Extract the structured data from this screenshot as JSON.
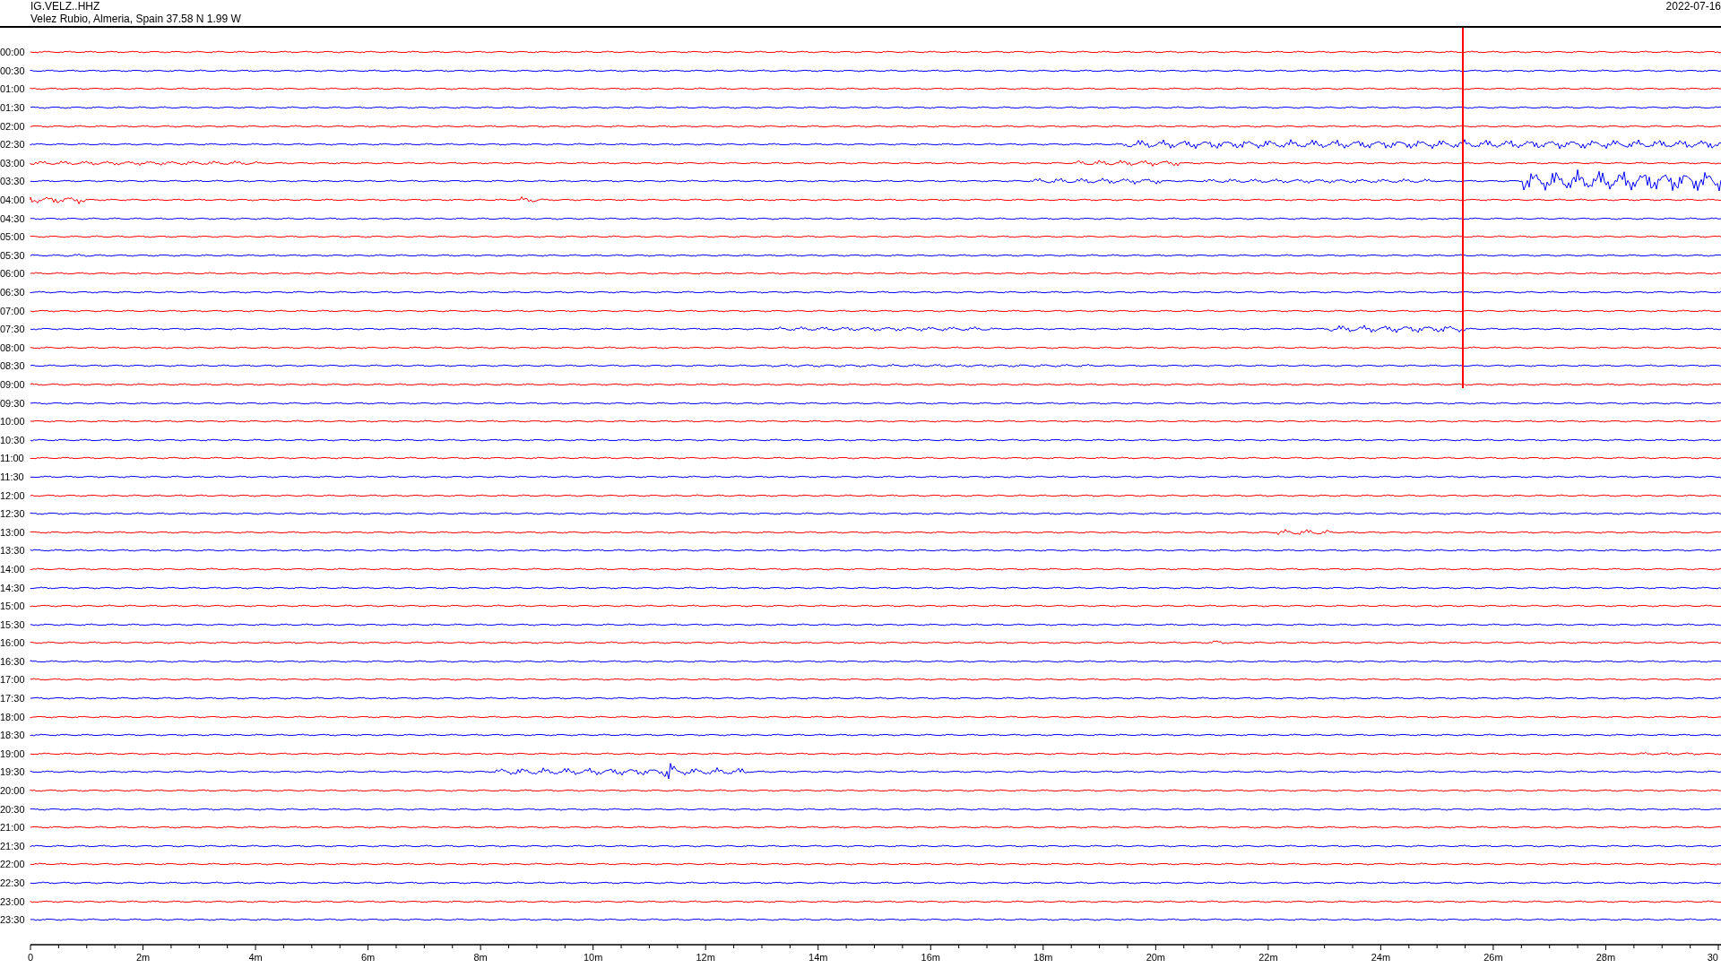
{
  "header": {
    "station": "IG.VELZ..HHZ",
    "location": "Velez Rubio, Almeria, Spain  37.58 N 1.99 W",
    "date": "2022-07-16"
  },
  "traces": [
    {
      "label": "00:00",
      "color": "#ff0000"
    },
    {
      "label": "00:30",
      "color": "#0000ff"
    },
    {
      "label": "01:00",
      "color": "#ff0000"
    },
    {
      "label": "01:30",
      "color": "#0000ff"
    },
    {
      "label": "02:00",
      "color": "#ff0000"
    },
    {
      "label": "02:30",
      "color": "#0000ff"
    },
    {
      "label": "03:00",
      "color": "#ff0000"
    },
    {
      "label": "03:30",
      "color": "#0000ff"
    },
    {
      "label": "04:00",
      "color": "#ff0000"
    },
    {
      "label": "04:30",
      "color": "#0000ff"
    },
    {
      "label": "05:00",
      "color": "#ff0000"
    },
    {
      "label": "05:30",
      "color": "#0000ff"
    },
    {
      "label": "06:00",
      "color": "#ff0000"
    },
    {
      "label": "06:30",
      "color": "#0000ff"
    },
    {
      "label": "07:00",
      "color": "#ff0000"
    },
    {
      "label": "07:30",
      "color": "#0000ff"
    },
    {
      "label": "08:00",
      "color": "#ff0000"
    },
    {
      "label": "08:30",
      "color": "#0000ff"
    },
    {
      "label": "09:00",
      "color": "#ff0000"
    },
    {
      "label": "09:30",
      "color": "#0000ff"
    },
    {
      "label": "10:00",
      "color": "#ff0000"
    },
    {
      "label": "10:30",
      "color": "#0000ff"
    },
    {
      "label": "11:00",
      "color": "#ff0000"
    },
    {
      "label": "11:30",
      "color": "#0000ff"
    },
    {
      "label": "12:00",
      "color": "#ff0000"
    },
    {
      "label": "12:30",
      "color": "#0000ff"
    },
    {
      "label": "13:00",
      "color": "#ff0000"
    },
    {
      "label": "13:30",
      "color": "#0000ff"
    },
    {
      "label": "14:00",
      "color": "#ff0000"
    },
    {
      "label": "14:30",
      "color": "#0000ff"
    },
    {
      "label": "15:00",
      "color": "#ff0000"
    },
    {
      "label": "15:30",
      "color": "#0000ff"
    },
    {
      "label": "16:00",
      "color": "#ff0000"
    },
    {
      "label": "16:30",
      "color": "#0000ff"
    },
    {
      "label": "17:00",
      "color": "#ff0000"
    },
    {
      "label": "17:30",
      "color": "#0000ff"
    },
    {
      "label": "18:00",
      "color": "#ff0000"
    },
    {
      "label": "18:30",
      "color": "#0000ff"
    },
    {
      "label": "19:00",
      "color": "#ff0000"
    },
    {
      "label": "19:30",
      "color": "#0000ff"
    },
    {
      "label": "20:00",
      "color": "#ff0000"
    },
    {
      "label": "20:30",
      "color": "#0000ff"
    },
    {
      "label": "21:00",
      "color": "#ff0000"
    },
    {
      "label": "21:30",
      "color": "#0000ff"
    },
    {
      "label": "22:00",
      "color": "#ff0000"
    },
    {
      "label": "22:30",
      "color": "#0000ff"
    },
    {
      "label": "23:00",
      "color": "#ff0000"
    },
    {
      "label": "23:30",
      "color": "#0000ff"
    }
  ],
  "axis": {
    "ticks": [
      "0",
      "2m",
      "4m",
      "6m",
      "8m",
      "10m",
      "12m",
      "14m",
      "16m",
      "18m",
      "20m",
      "22m",
      "24m",
      "26m",
      "28m",
      "30"
    ]
  }
}
